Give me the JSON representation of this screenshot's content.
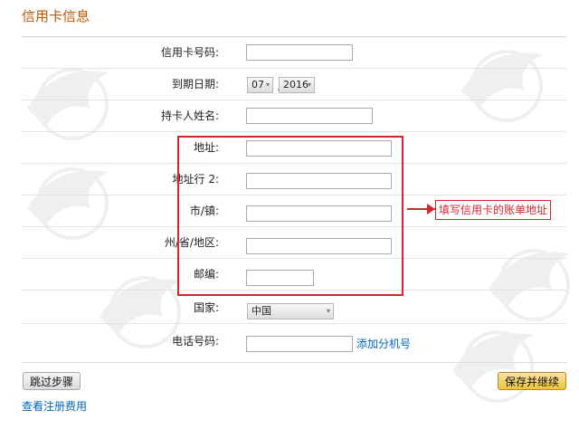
{
  "title": "信用卡信息",
  "form": {
    "card_number_label": "信用卡号码:",
    "expiry_label": "到期日期:",
    "expiry_month": "07",
    "expiry_separator": "/",
    "expiry_year": "2016",
    "cardholder_label": "持卡人姓名:",
    "address_label": "地址:",
    "address2_label": "地址行 2:",
    "city_label": "市/镇:",
    "state_label": "州/省/地区:",
    "zip_label": "邮编:",
    "country_label": "国家:",
    "country_value": "中国",
    "phone_label": "电话号码:",
    "add_extension_link": "添加分机号"
  },
  "annotation": {
    "callout_text": "填写信用卡的账单地址",
    "accent_color": "#d9262e"
  },
  "buttons": {
    "skip": "跳过步骤",
    "save": "保存并继续"
  },
  "footer": {
    "view_fees_link": "查看注册费用"
  },
  "colors": {
    "title": "#c45500",
    "link": "#0066c0",
    "save_button": "#eec53e"
  }
}
